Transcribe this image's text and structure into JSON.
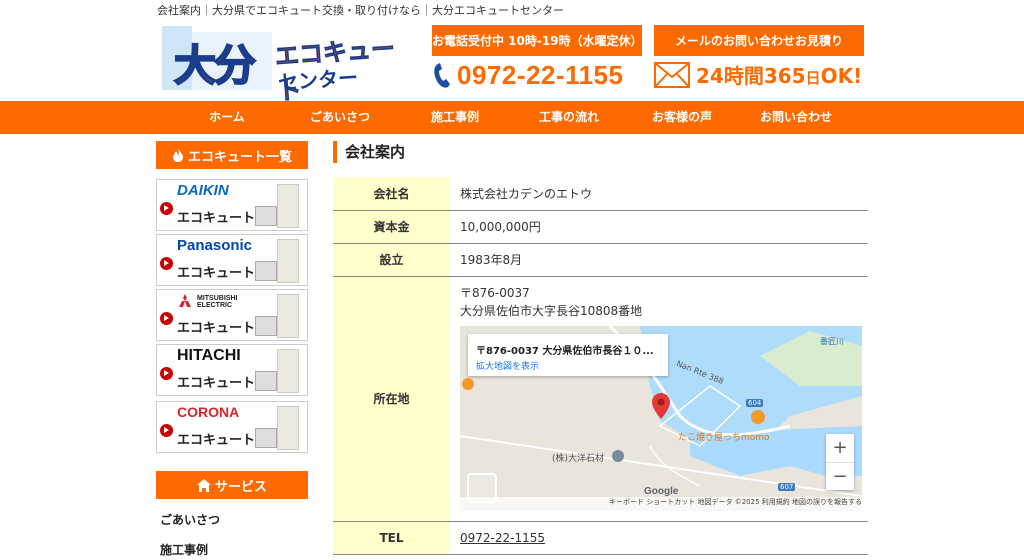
{
  "header": {
    "tagline": "会社案内｜大分県でエコキュート交換・取り付けなら｜大分エコキュートセンター",
    "logo_main": "大分",
    "logo_sub1": "エコキュート",
    "logo_sub2": "センター",
    "phone_hours": "お電話受付中 10時-19時（水曜定休）",
    "mail_button": "メールのお問い合わせお見積り",
    "phone": "0972-22-1155",
    "mail_hours_prefix": "24時間365",
    "mail_hours_day": "日",
    "mail_hours_suffix": "OK!",
    "accent": "#ff6a00"
  },
  "nav": [
    "ホーム",
    "ごあいさつ",
    "施工事例",
    "工事の流れ",
    "お客様の声",
    "お問い合わせ"
  ],
  "sidebar": {
    "eco_title": "エコキュート一覧",
    "brands": [
      {
        "name": "DAIKIN",
        "label": "エコキュート",
        "color": "#0a6ac0"
      },
      {
        "name": "Panasonic",
        "label": "エコキュート",
        "color": "#0046ad"
      },
      {
        "name": "MITSUBISHI ELECTRIC",
        "label": "エコキュート",
        "color": "#222222"
      },
      {
        "name": "HITACHI",
        "label": "エコキュート",
        "color": "#111111"
      },
      {
        "name": "CORONA",
        "label": "エコキュート",
        "color": "#d8242c"
      }
    ],
    "service_title": "サービス",
    "service_links": [
      "ごあいさつ",
      "施工事例"
    ]
  },
  "main": {
    "title": "会社案内",
    "rows": [
      {
        "key": "会社名",
        "value": "株式会社カデンのエトウ"
      },
      {
        "key": "資本金",
        "value": "10,000,000円"
      },
      {
        "key": "設立",
        "value": "1983年8月"
      },
      {
        "key": "所在地",
        "zip": "〒876-0037",
        "address": "大分県佐伯市大字長谷10808番地"
      },
      {
        "key": "TEL",
        "value": "0972-22-1155"
      }
    ],
    "map": {
      "card_title": "〒876-0037 大分県佐伯市長谷１０...",
      "card_link": "拡大地図を表示",
      "label_road": "Nan Rte 388",
      "label_river": "番匠川",
      "label_restaurant": "たこ焼き屋っちmomo",
      "label_stone": "(株)大洋石材",
      "route_604": "604",
      "route_607": "607",
      "google": "Google",
      "footer": "キーボード ショートカット   地図データ ©2025   利用規約   地図の誤りを報告する",
      "zoom_in": "+",
      "zoom_out": "−"
    }
  }
}
